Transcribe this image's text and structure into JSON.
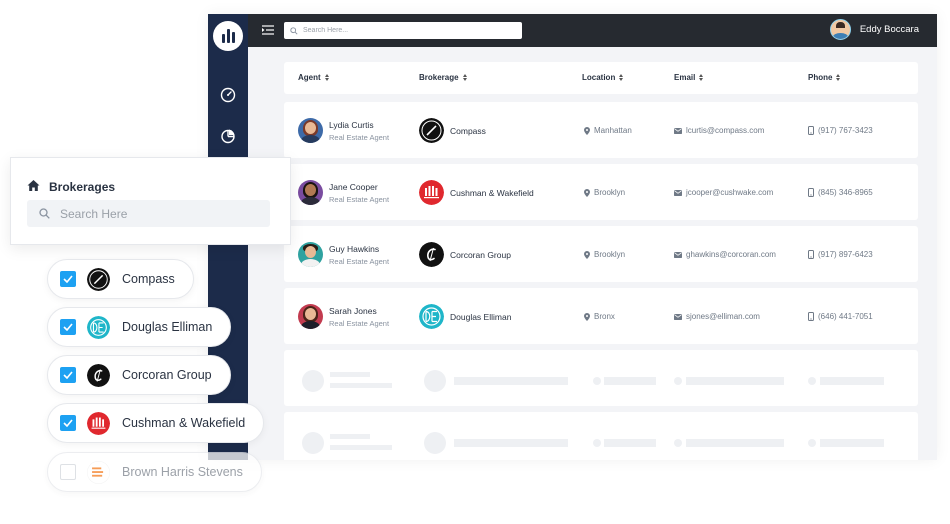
{
  "topbar": {
    "search_placeholder": "Search Here...",
    "user_name": "Eddy Boccara"
  },
  "sidebar": {
    "icons": [
      "speedometer-icon",
      "pie-chart-icon"
    ]
  },
  "table": {
    "columns": [
      "Agent",
      "Brokerage",
      "Location",
      "Email",
      "Phone"
    ],
    "rows": [
      {
        "name": "Lydia Curtis",
        "role": "Real Estate Agent",
        "brokerage": "Compass",
        "location": "Manhattan",
        "email": "lcurtis@compass.com",
        "phone": "(917) 767-3423"
      },
      {
        "name": "Jane Cooper",
        "role": "Real Estate Agent",
        "brokerage": "Cushman & Wakefield",
        "location": "Brooklyn",
        "email": "jcooper@cushwake.com",
        "phone": "(845) 346-8965"
      },
      {
        "name": "Guy Hawkins",
        "role": "Real Estate Agent",
        "brokerage": "Corcoran Group",
        "location": "Brooklyn",
        "email": "ghawkins@corcoran.com",
        "phone": "(917) 897-6423"
      },
      {
        "name": "Sarah Jones",
        "role": "Real Estate Agent",
        "brokerage": "Douglas Elliman",
        "location": "Bronx",
        "email": "sjones@elliman.com",
        "phone": "(646) 441-7051"
      }
    ]
  },
  "panel": {
    "title": "Brokerages",
    "search_placeholder": "Search Here"
  },
  "filters": [
    {
      "label": "Compass",
      "checked": true
    },
    {
      "label": "Douglas Elliman",
      "checked": true
    },
    {
      "label": "Corcoran Group",
      "checked": true
    },
    {
      "label": "Cushman & Wakefield",
      "checked": true
    },
    {
      "label": "Brown Harris Stevens",
      "checked": false
    }
  ],
  "logo_text": {
    "brown_harris_stevens": "Brown Harris Stevens"
  },
  "colors": {
    "sidebar": "#1c2b4a",
    "topbar": "#262a30",
    "checkbox": "#1da1f2",
    "douglas_elliman": "#1fb6c9",
    "cushman": "#e0282e",
    "bhs": "#f47b20"
  }
}
